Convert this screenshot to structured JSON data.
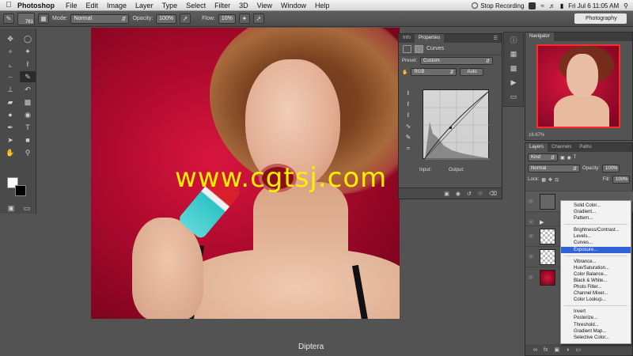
{
  "menubar": {
    "app": "Photoshop",
    "items": [
      "File",
      "Edit",
      "Image",
      "Layer",
      "Type",
      "Select",
      "Filter",
      "3D",
      "View",
      "Window",
      "Help"
    ],
    "recording": "Stop Recording",
    "clock": "Fri Jul 6  11:05 AM"
  },
  "options": {
    "brush_size": "761",
    "mode_label": "Mode:",
    "mode_value": "Normal",
    "opacity_label": "Opacity:",
    "opacity_value": "100%",
    "flow_label": "Flow:",
    "flow_value": "10%",
    "workspace": "Photography"
  },
  "document": {
    "title": "Diptera",
    "watermark": "www.cgtsj.com"
  },
  "properties": {
    "tabs": [
      "Info",
      "Properties"
    ],
    "adjustment": "Curves",
    "preset_label": "Preset:",
    "preset_value": "Custom",
    "channel": "RGB",
    "auto": "Auto",
    "input_label": "Input:",
    "output_label": "Output:"
  },
  "navigator": {
    "title": "Navigator",
    "zoom": "16.67%"
  },
  "layers": {
    "tabs": [
      "Layers",
      "Channels",
      "Paths"
    ],
    "kind": "Kind",
    "blend": "Normal",
    "opacity_label": "Opacity:",
    "opacity_value": "100%",
    "lock_label": "Lock:",
    "fill_label": "Fill:",
    "fill_value": "100%"
  },
  "adjust_menu": {
    "group1": [
      "Solid Color...",
      "Gradient...",
      "Pattern..."
    ],
    "group2": [
      "Brightness/Contrast...",
      "Levels...",
      "Curves...",
      "Exposure..."
    ],
    "group3": [
      "Vibrance...",
      "Hue/Saturation...",
      "Color Balance...",
      "Black & White...",
      "Photo Filter...",
      "Channel Mixer...",
      "Color Lookup..."
    ],
    "group4": [
      "Invert",
      "Posterize...",
      "Threshold...",
      "Gradient Map...",
      "Selective Color..."
    ],
    "highlighted": "Exposure..."
  },
  "colors": {
    "accent_highlight": "#3063d6",
    "background_red": "#c0102f"
  }
}
